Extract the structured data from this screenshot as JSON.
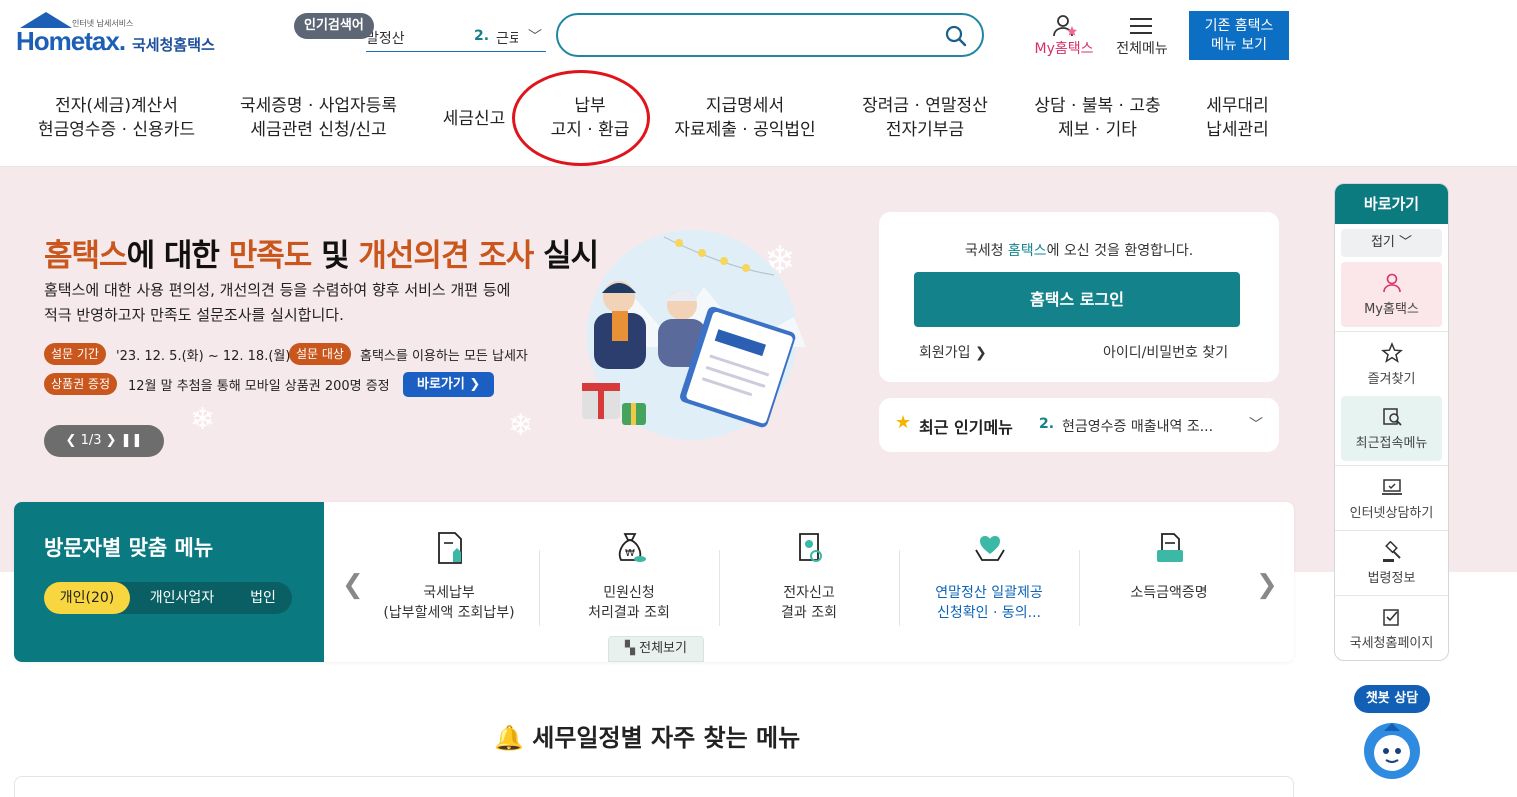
{
  "header": {
    "logo_text": "Hometax.",
    "logo_tagline": "인터넷 납세서비스",
    "logo_korean": "국세청홈택스",
    "popular_label": "인기검색어",
    "popular_prev_word": "말정산",
    "popular_rank": "2.",
    "popular_word": "근로",
    "search_placeholder": "",
    "my_label": "My홈택스",
    "all_menu_label": "전체메뉴",
    "old_menu_line1": "기존 홈택스",
    "old_menu_line2": "메뉴 보기"
  },
  "gnb": [
    {
      "l1": "전자(세금)계산서",
      "l2": "현금영수증 · 신용카드"
    },
    {
      "l1": "국세증명 · 사업자등록",
      "l2": "세금관련 신청/신고"
    },
    {
      "l1": "세금신고",
      "l2": ""
    },
    {
      "l1": "납부",
      "l2": "고지 · 환급"
    },
    {
      "l1": "지급명세서",
      "l2": "자료제출 · 공익법인"
    },
    {
      "l1": "장려금 · 연말정산",
      "l2": "전자기부금"
    },
    {
      "l1": "상담 · 불복 · 고충",
      "l2": "제보 · 기타"
    },
    {
      "l1": "세무대리",
      "l2": "납세관리"
    }
  ],
  "hero": {
    "title_a": "홈택스",
    "title_b": "에 대한 ",
    "title_c": "만족도",
    "title_d": " 및 ",
    "title_e": "개선의견 조사",
    "title_f": " 실시",
    "desc1": "홈택스에 대한 사용 편의성, 개선의견 등을 수렴하여 향후 서비스 개편 등에",
    "desc2": "적극 반영하고자 만족도 설문조사를 실시합니다.",
    "period_label": "설문 기간",
    "period_value": "'23. 12. 5.(화) ~ 12. 18.(월)",
    "target_label": "설문 대상",
    "target_value": "홈택스를 이용하는 모든 납세자",
    "gift_label": "상품권 증정",
    "gift_value": "12월 말 추첨을 통해 모바일 상품권 200명 증정",
    "goto_label": "바로가기 ❯",
    "pager": "❮  1/3  ❯    ❚❚"
  },
  "login": {
    "welcome_a": "국세청 ",
    "welcome_b": "홈택스",
    "welcome_c": "에 오신 것을 환영합니다.",
    "login_button": "홈택스 로그인",
    "signup": "회원가입 ❯",
    "find": "아이디/비밀번호 찾기"
  },
  "recent": {
    "label": "최근 인기메뉴",
    "rank": "2.",
    "item": "현금영수증 매출내역 조...",
    "chevron": "﹀"
  },
  "quick": {
    "title": "바로가기",
    "fold": "접기 ﹀",
    "items": [
      "My홈택스",
      "즐겨찾기",
      "최근접속메뉴",
      "인터넷상담하기",
      "법령정보",
      "국세청홈페이지"
    ],
    "chatbot": "챗봇 상담"
  },
  "visitor": {
    "title": "방문자별 맞춤 메뉴",
    "tabs": [
      "개인(20)",
      "개인사업자",
      "법인"
    ],
    "items": [
      {
        "l1": "국세납부",
        "l2": "(납부할세액 조회납부)"
      },
      {
        "l1": "민원신청",
        "l2": "처리결과 조회"
      },
      {
        "l1": "전자신고",
        "l2": "결과 조회"
      },
      {
        "l1": "연말정산 일괄제공",
        "l2": "신청확인 · 동의..."
      },
      {
        "l1": "소득금액증명",
        "l2": ""
      }
    ],
    "view_all": "전체보기"
  },
  "schedule": {
    "title": "세무일정별 자주 찾는 메뉴"
  },
  "colors": {
    "teal": "#0b7a80",
    "orange": "#c9561c",
    "blue": "#1b5fc2",
    "hero_bg": "#f6e9eb",
    "highlight_circle": "#e0141c"
  }
}
